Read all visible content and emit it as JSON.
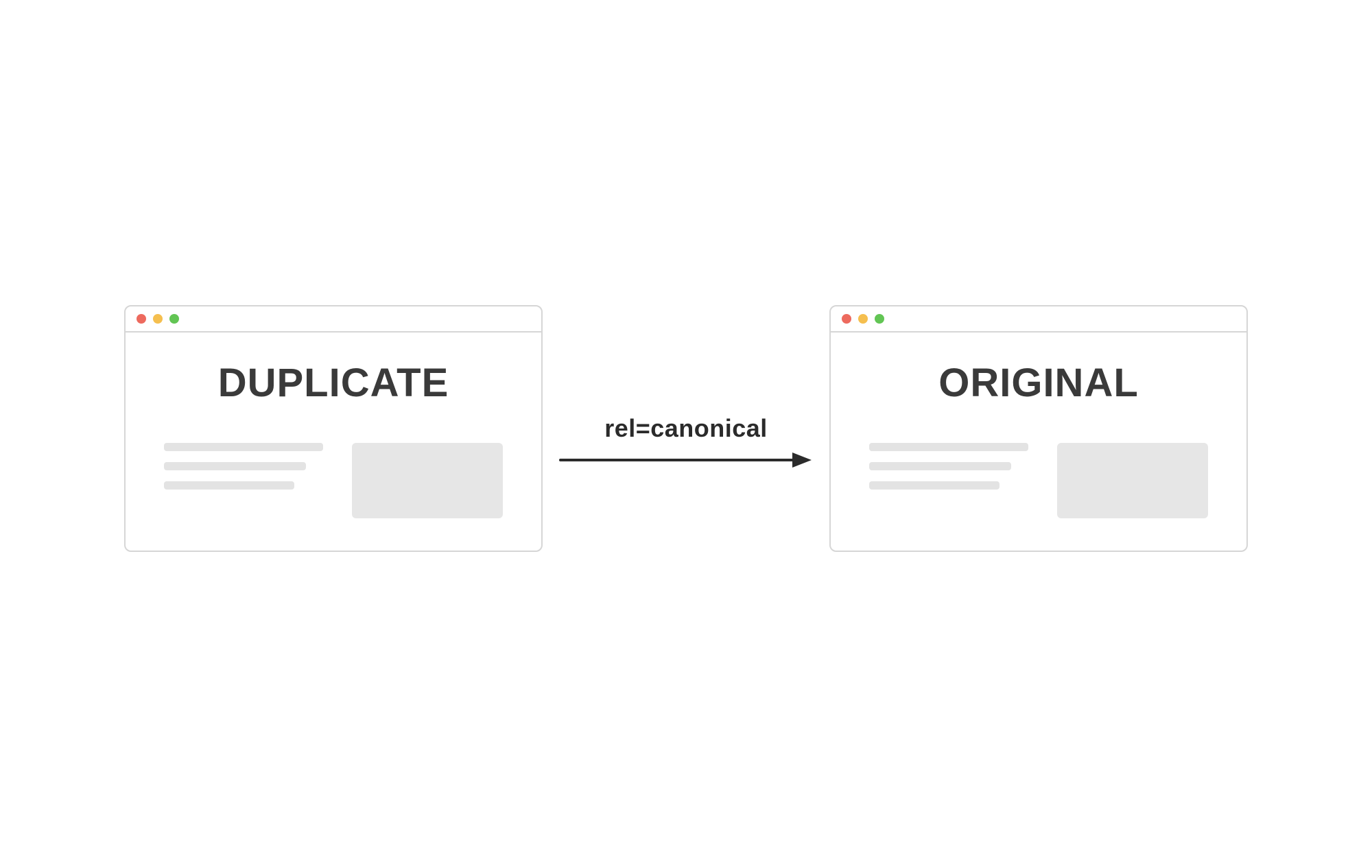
{
  "left_window": {
    "title": "DUPLICATE"
  },
  "right_window": {
    "title": "ORIGINAL"
  },
  "arrow": {
    "label": "rel=canonical"
  },
  "colors": {
    "dot_red": "#ED6A5E",
    "dot_yellow": "#F5BF4F",
    "dot_green": "#62C554",
    "border": "#d6d6d6",
    "placeholder": "#e3e3e3",
    "text": "#3a3a3a"
  }
}
